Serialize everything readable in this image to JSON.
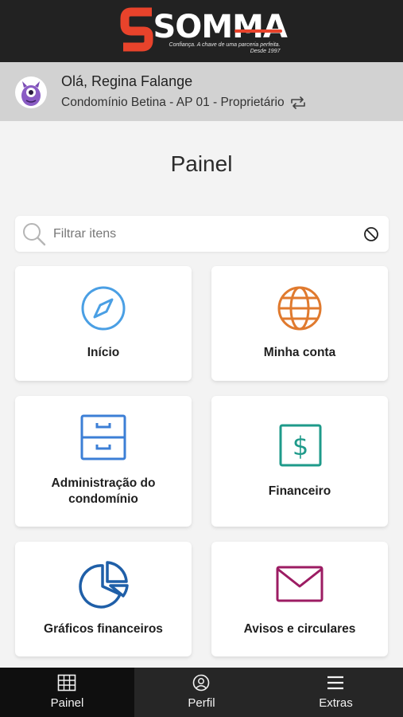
{
  "header": {
    "logo": {
      "name": "SOMMA",
      "tagline_line1": "Confiança. A chave de uma parceria perfeita.",
      "tagline_line2": "Desde 1997"
    }
  },
  "user": {
    "greeting": "Olá, Regina Falange",
    "condo_line": "Condomínio Betina - AP 01 - Proprietário",
    "avatar_icon": "monster-avatar-icon",
    "switch_icon": "swap-icon"
  },
  "page": {
    "title": "Painel"
  },
  "search": {
    "placeholder": "Filtrar itens",
    "value": ""
  },
  "tiles": [
    {
      "label": "Início",
      "icon": "compass-icon",
      "color": "#4a9fe4"
    },
    {
      "label": "Minha conta",
      "icon": "globe-icon",
      "color": "#e07a2e"
    },
    {
      "label_line1": "Administração do",
      "label_line2": "condomínio",
      "icon": "file-cabinet-icon",
      "color": "#3c7fd6"
    },
    {
      "label": "Financeiro",
      "icon": "dollar-icon",
      "color": "#1e9a8a"
    },
    {
      "label": "Gráficos financeiros",
      "icon": "pie-chart-icon",
      "color": "#1f5fa8"
    },
    {
      "label": "Avisos e circulares",
      "icon": "envelope-icon",
      "color": "#9c1c63"
    }
  ],
  "bottom_nav": [
    {
      "label": "Painel",
      "icon": "grid-icon",
      "active": true
    },
    {
      "label": "Perfil",
      "icon": "user-circle-icon",
      "active": false
    },
    {
      "label": "Extras",
      "icon": "menu-icon",
      "active": false
    }
  ],
  "colors": {
    "topbar": "#222222",
    "userbar": "#d2d2d2",
    "brand_red": "#e8432b",
    "bottombar": "#262626"
  }
}
